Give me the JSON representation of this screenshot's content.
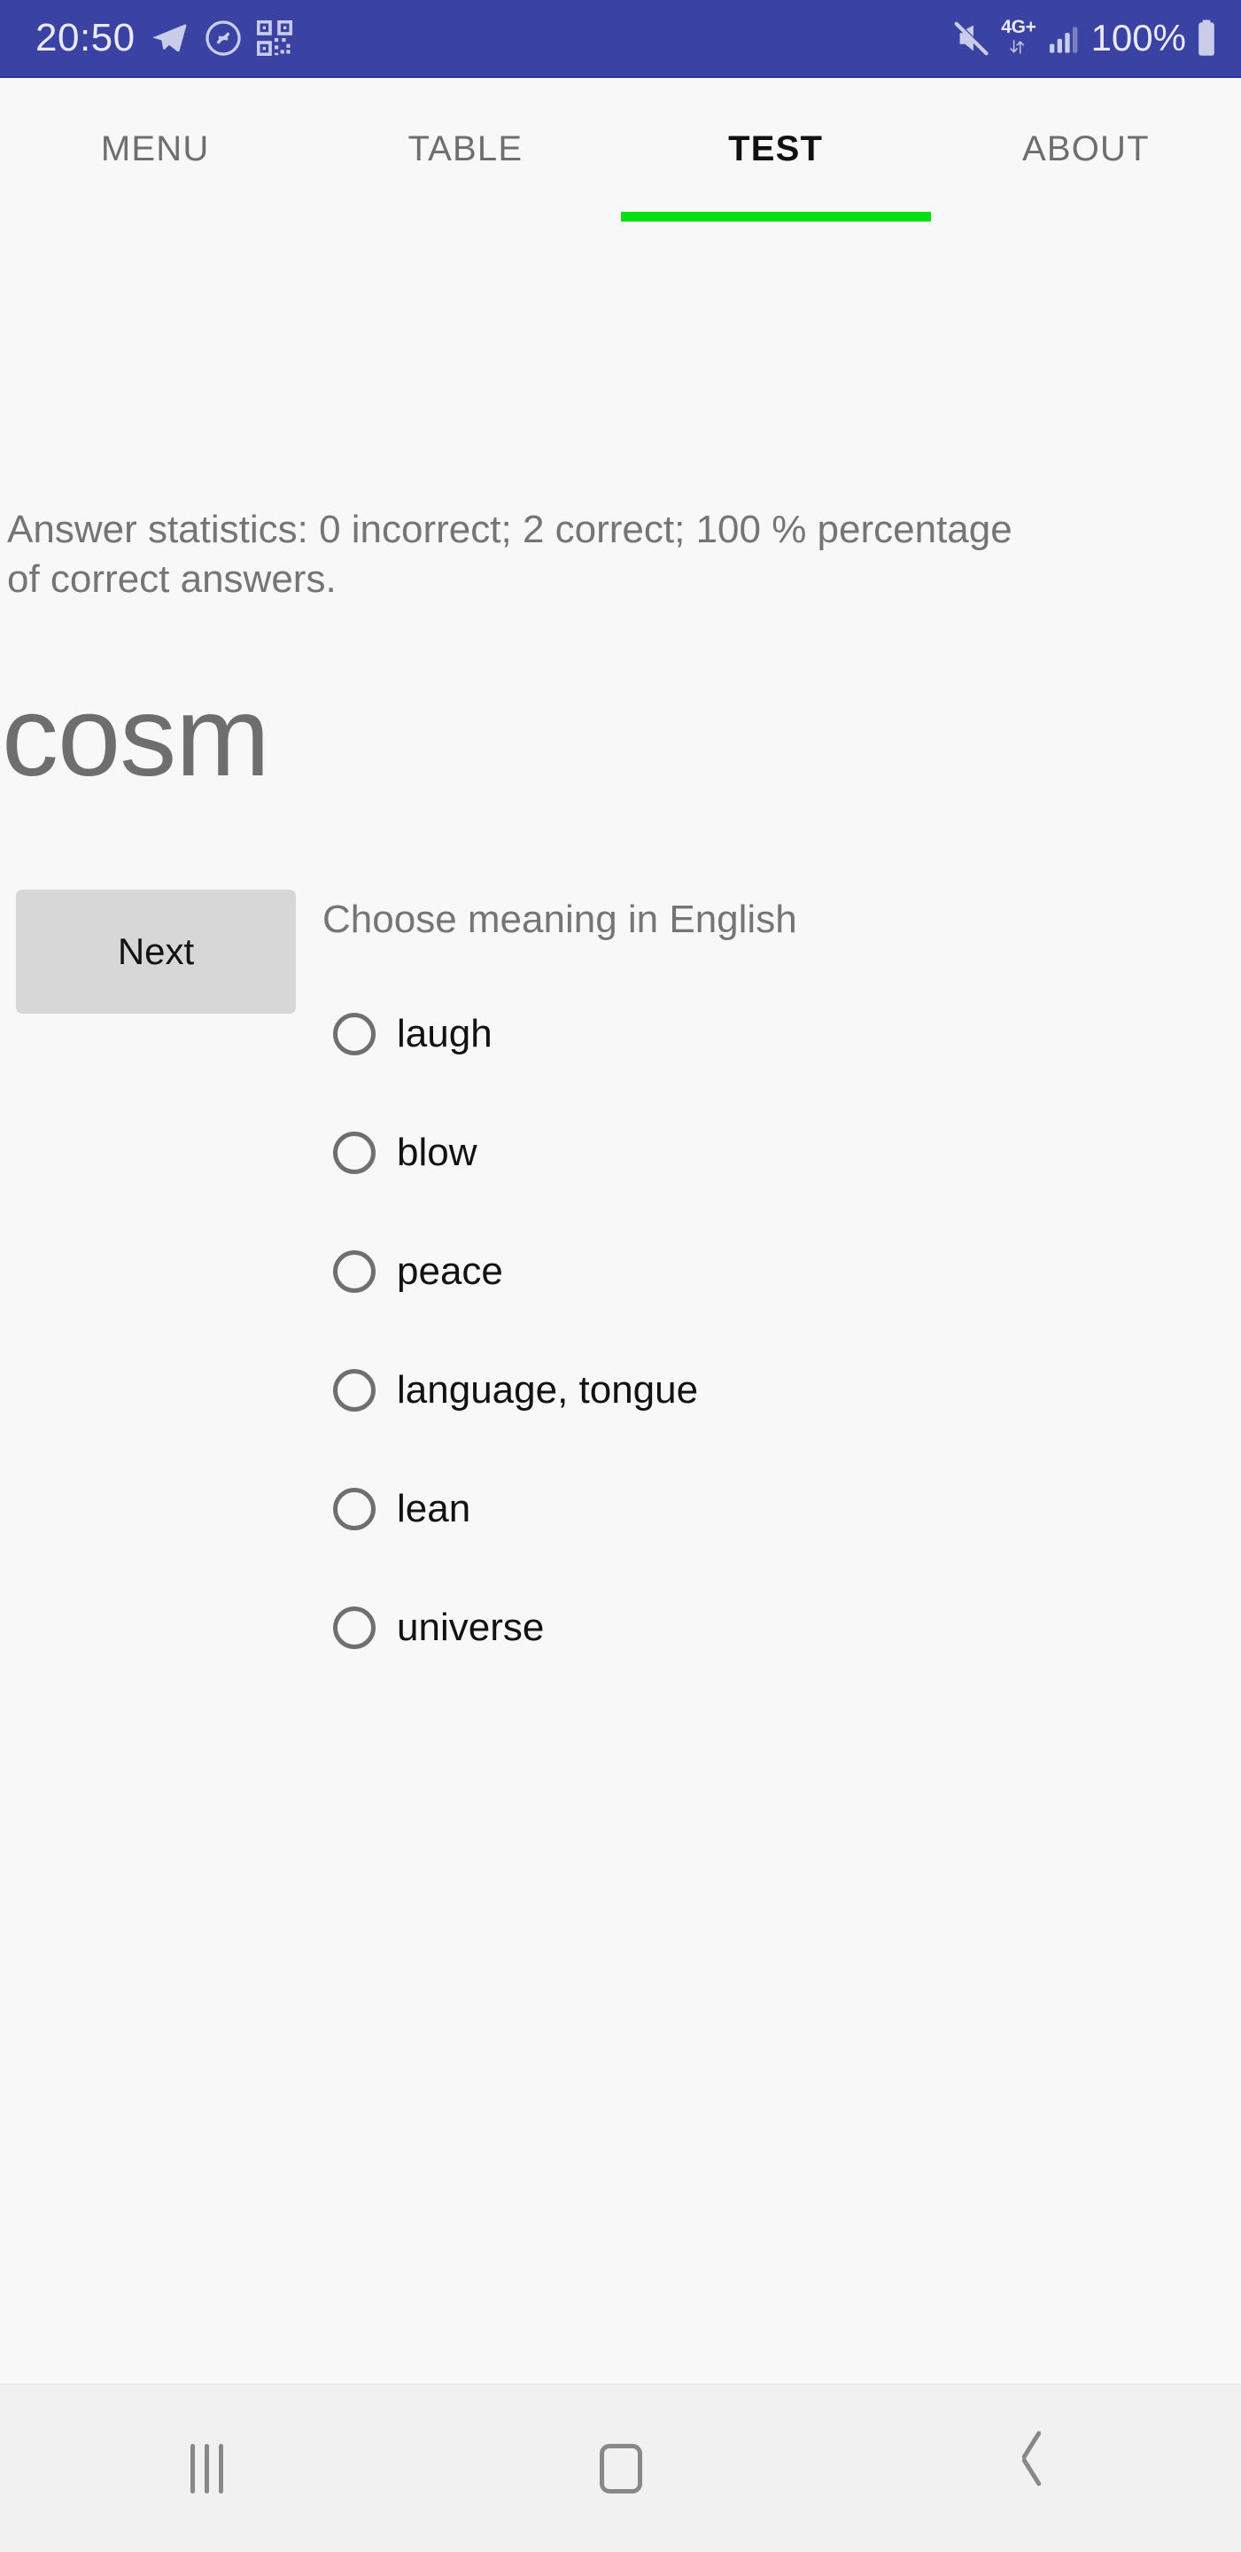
{
  "status_bar": {
    "time": "20:50",
    "battery_percent": "100%",
    "network_label": "4G+",
    "icons": [
      "telegram-icon",
      "shazam-icon",
      "qr-code-icon",
      "mute-icon",
      "data-transfer-icon",
      "signal-bars-icon",
      "battery-icon"
    ],
    "background_color": "#3A43A3",
    "foreground_color": "#E9EAF6"
  },
  "tabs": {
    "items": [
      {
        "label": "MENU",
        "active": false
      },
      {
        "label": "TABLE",
        "active": false
      },
      {
        "label": "TEST",
        "active": true
      },
      {
        "label": "ABOUT",
        "active": false
      }
    ],
    "active_index": 2,
    "indicator_color": "#00DF10",
    "active_text_color": "#101010",
    "inactive_text_color": "#6E6E6E"
  },
  "test": {
    "statistics": "Answer statistics: 0 incorrect; 2 correct; 100 % percentage of correct answers.",
    "incorrect_count": "0",
    "correct_count": "2",
    "percent_correct": "100 %",
    "word": "cosm",
    "next_label": "Next",
    "prompt": "Choose meaning in English",
    "options": [
      {
        "label": "laugh",
        "selected": false
      },
      {
        "label": "blow",
        "selected": false
      },
      {
        "label": "peace",
        "selected": false
      },
      {
        "label": "language, tongue",
        "selected": false
      },
      {
        "label": "lean",
        "selected": false
      },
      {
        "label": "universe",
        "selected": false
      }
    ]
  },
  "nav_bar": {
    "recents_label": "recents",
    "home_label": "home",
    "back_label": "back",
    "background_color": "#F1F1F1",
    "icon_color": "#888888"
  }
}
